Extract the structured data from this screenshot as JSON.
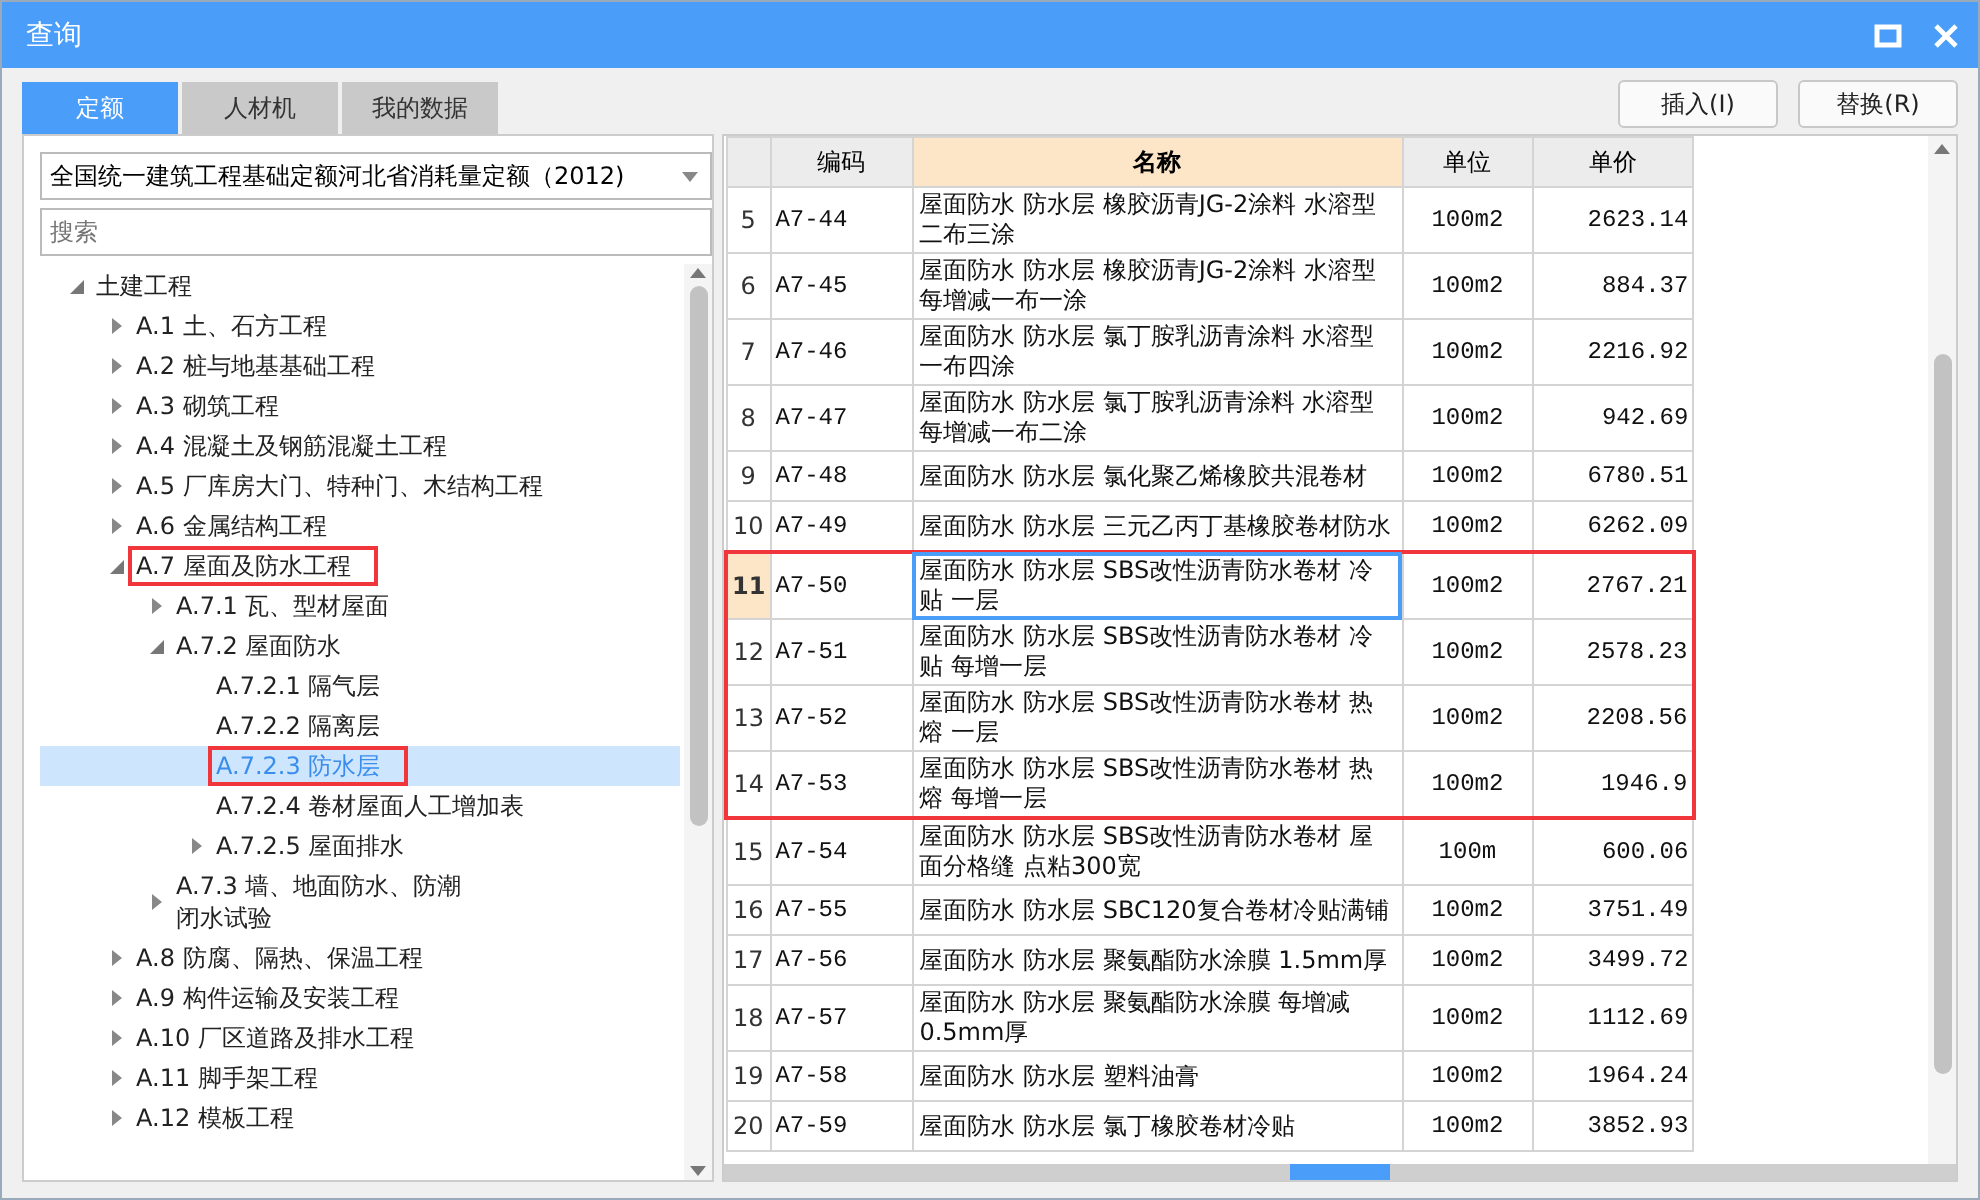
{
  "window": {
    "title": "查询"
  },
  "tabs": [
    {
      "label": "定额",
      "selected": true
    },
    {
      "label": "人材机",
      "selected": false
    },
    {
      "label": "我的数据",
      "selected": false
    }
  ],
  "buttons": [
    "插入(I)",
    "替换(R)"
  ],
  "library_select": {
    "value": "全国统一建筑工程基础定额河北省消耗量定额（2012)"
  },
  "search": {
    "placeholder": "搜索"
  },
  "tree": [
    {
      "label": "土建工程",
      "expanded": true,
      "selected": false,
      "annotated": false,
      "children": [
        {
          "label": "A.1 土、石方工程",
          "expanded": false,
          "selected": false,
          "annotated": false
        },
        {
          "label": "A.2 桩与地基基础工程",
          "expanded": false,
          "selected": false,
          "annotated": false
        },
        {
          "label": "A.3 砌筑工程",
          "expanded": false,
          "selected": false,
          "annotated": false
        },
        {
          "label": "A.4 混凝土及钢筋混凝土工程",
          "expanded": false,
          "selected": false,
          "annotated": false
        },
        {
          "label": "A.5 厂库房大门、特种门、木结构工程",
          "expanded": false,
          "selected": false,
          "annotated": false
        },
        {
          "label": "A.6 金属结构工程",
          "expanded": false,
          "selected": false,
          "annotated": false
        },
        {
          "label": "A.7 屋面及防水工程",
          "expanded": true,
          "selected": false,
          "annotated": true,
          "children": [
            {
              "label": "A.7.1 瓦、型材屋面",
              "expanded": false,
              "selected": false,
              "annotated": false
            },
            {
              "label": "A.7.2 屋面防水",
              "expanded": true,
              "selected": false,
              "annotated": false,
              "children": [
                {
                  "label": "A.7.2.1 隔气层",
                  "selected": false,
                  "annotated": false
                },
                {
                  "label": "A.7.2.2 隔离层",
                  "selected": false,
                  "annotated": false
                },
                {
                  "label": "A.7.2.3 防水层",
                  "selected": true,
                  "annotated": true
                },
                {
                  "label": "A.7.2.4 卷材屋面人工增加表",
                  "selected": false,
                  "annotated": false
                },
                {
                  "label": "A.7.2.5 屋面排水",
                  "expanded": false,
                  "selected": false,
                  "annotated": false
                }
              ]
            },
            {
              "label": "A.7.3 墙、地面防水、防潮闭水试验",
              "expanded": false,
              "selected": false,
              "annotated": false
            }
          ]
        },
        {
          "label": "A.8 防腐、隔热、保温工程",
          "expanded": false,
          "selected": false,
          "annotated": false
        },
        {
          "label": "A.9 构件运输及安装工程",
          "expanded": false,
          "selected": false,
          "annotated": false
        },
        {
          "label": "A.10 厂区道路及排水工程",
          "expanded": false,
          "selected": false,
          "annotated": false
        },
        {
          "label": "A.11 脚手架工程",
          "expanded": false,
          "selected": false,
          "annotated": false
        },
        {
          "label": "A.12 模板工程",
          "expanded": false,
          "selected": false,
          "annotated": false
        }
      ]
    }
  ],
  "table": {
    "columns": [
      {
        "label": "编码",
        "selected": false
      },
      {
        "label": "名称",
        "selected": true
      },
      {
        "label": "单位",
        "selected": false
      },
      {
        "label": "单价",
        "selected": false
      }
    ],
    "rows": [
      {
        "no": "5",
        "code": "A7-44",
        "name": "屋面防水 防水层 橡胶沥青JG-2涂料 水溶型二布三涂",
        "unit": "100m2",
        "price": "2623.14",
        "selected": false,
        "annotated": false
      },
      {
        "no": "6",
        "code": "A7-45",
        "name": "屋面防水 防水层 橡胶沥青JG-2涂料 水溶型每增减一布一涂",
        "unit": "100m2",
        "price": "884.37",
        "selected": false,
        "annotated": false
      },
      {
        "no": "7",
        "code": "A7-46",
        "name": "屋面防水 防水层 氯丁胺乳沥青涂料 水溶型一布四涂",
        "unit": "100m2",
        "price": "2216.92",
        "selected": false,
        "annotated": false
      },
      {
        "no": "8",
        "code": "A7-47",
        "name": "屋面防水 防水层 氯丁胺乳沥青涂料 水溶型每增减一布二涂",
        "unit": "100m2",
        "price": "942.69",
        "selected": false,
        "annotated": false
      },
      {
        "no": "9",
        "code": "A7-48",
        "name": "屋面防水 防水层 氯化聚乙烯橡胶共混卷材",
        "unit": "100m2",
        "price": "6780.51",
        "selected": false,
        "annotated": false
      },
      {
        "no": "10",
        "code": "A7-49",
        "name": "屋面防水 防水层 三元乙丙丁基橡胶卷材防水",
        "unit": "100m2",
        "price": "6262.09",
        "selected": false,
        "annotated": false
      },
      {
        "no": "11",
        "code": "A7-50",
        "name": "屋面防水 防水层 SBS改性沥青防水卷材 冷贴 一层",
        "unit": "100m2",
        "price": "2767.21",
        "selected": true,
        "annotated": true
      },
      {
        "no": "12",
        "code": "A7-51",
        "name": "屋面防水 防水层 SBS改性沥青防水卷材 冷贴 每增一层",
        "unit": "100m2",
        "price": "2578.23",
        "selected": false,
        "annotated": true
      },
      {
        "no": "13",
        "code": "A7-52",
        "name": "屋面防水 防水层 SBS改性沥青防水卷材 热熔 一层",
        "unit": "100m2",
        "price": "2208.56",
        "selected": false,
        "annotated": true
      },
      {
        "no": "14",
        "code": "A7-53",
        "name": "屋面防水 防水层 SBS改性沥青防水卷材 热熔 每增一层",
        "unit": "100m2",
        "price": "1946.9",
        "selected": false,
        "annotated": true
      },
      {
        "no": "15",
        "code": "A7-54",
        "name": "屋面防水 防水层 SBS改性沥青防水卷材 屋面分格缝 点粘300宽",
        "unit": "100m",
        "price": "600.06",
        "selected": false,
        "annotated": false
      },
      {
        "no": "16",
        "code": "A7-55",
        "name": "屋面防水 防水层 SBC120复合卷材冷贴满铺",
        "unit": "100m2",
        "price": "3751.49",
        "selected": false,
        "annotated": false
      },
      {
        "no": "17",
        "code": "A7-56",
        "name": "屋面防水 防水层 聚氨酯防水涂膜 1.5mm厚",
        "unit": "100m2",
        "price": "3499.72",
        "selected": false,
        "annotated": false
      },
      {
        "no": "18",
        "code": "A7-57",
        "name": "屋面防水 防水层 聚氨酯防水涂膜 每增减0.5mm厚",
        "unit": "100m2",
        "price": "1112.69",
        "selected": false,
        "annotated": false
      },
      {
        "no": "19",
        "code": "A7-58",
        "name": "屋面防水 防水层 塑料油膏",
        "unit": "100m2",
        "price": "1964.24",
        "selected": false,
        "annotated": false
      },
      {
        "no": "20",
        "code": "A7-59",
        "name": "屋面防水 防水层 氯丁橡胶卷材冷贴",
        "unit": "100m2",
        "price": "3852.93",
        "selected": false,
        "annotated": false
      }
    ]
  }
}
